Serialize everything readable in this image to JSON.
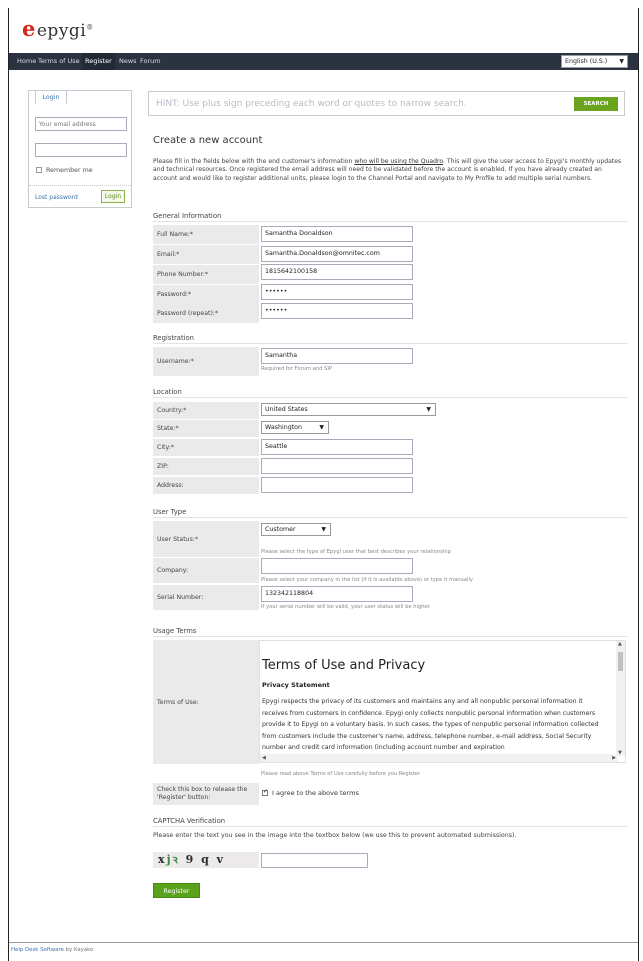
{
  "brand": {
    "logo_text": "epygi",
    "logo_mark": "e"
  },
  "nav": {
    "items": [
      {
        "label": "Home"
      },
      {
        "label": "Terms of Use"
      },
      {
        "label": "Register"
      },
      {
        "label": "News"
      },
      {
        "label": "Forum"
      }
    ],
    "language": "English (U.S.)"
  },
  "login": {
    "tab": "Login",
    "email_placeholder": "Your email address",
    "remember": "Remember me",
    "lost_password": "Lost password",
    "button": "Login"
  },
  "search": {
    "placeholder": "HINT: Use plus sign preceding each word or quotes to narrow search.",
    "button": "SEARCH"
  },
  "page": {
    "title": "Create a new account",
    "intro_1": "Please fill in the fields below with the end customer's information ",
    "intro_link": "who will be using the Quadro",
    "intro_2": ". This will give the user access to Epygi's monthly updates and technical resources. Once registered the email address will need to be validated before the account is enabled. If you have already created an account and would like to register additional units, please login to the Channel Portal and navigate to My Profile to add multiple serial numbers."
  },
  "general": {
    "title": "General Information",
    "full_name_label": "Full Name:*",
    "full_name": "Samantha Donaldson",
    "email_label": "Email:*",
    "email": "Samantha.Donaldson@omnitec.com",
    "phone_label": "Phone Number:*",
    "phone": "1815642100158",
    "password_label": "Password:*",
    "password": "••••••",
    "password2_label": "Password (repeat):*",
    "password2": "••••••"
  },
  "registration": {
    "title": "Registration",
    "username_label": "Username:*",
    "username": "Samantha",
    "username_help": "Required for Forum and SIP"
  },
  "location": {
    "title": "Location",
    "country_label": "Country:*",
    "country": "United States",
    "state_label": "State:*",
    "state": "Washington",
    "city_label": "City:*",
    "city": "Seattle",
    "zip_label": "ZIP:",
    "zip": "",
    "address_label": "Address:",
    "address": ""
  },
  "user_type": {
    "title": "User Type",
    "status_label": "User Status:*",
    "status": "Customer",
    "status_help": "Please select the type of Epygi user that best describes your relationship",
    "company_label": "Company:",
    "company": "",
    "company_help": "Please select your company in the list (if it is available above) or type it manually",
    "serial_label": "Serial Number:",
    "serial": "132342118804",
    "serial_help": "If your serial number will be valid, your user status will be higher"
  },
  "usage": {
    "title": "Usage Terms",
    "tos_label": "Terms of Use:",
    "tos_heading": "Terms of Use and Privacy",
    "tos_sub": "Privacy Statement",
    "tos_text": "Epygi respects the privacy of its customers and maintains any and all nonpublic personal information it receives from customers in confidence. Epygi only collects nonpublic personal information when customers provide it to Epygi on a voluntary basis. In such cases, the types of nonpublic personal information collected from customers include the customer's name, address, telephone number, e-mail address, Social Security number and credit card information (including account number and expiration",
    "tos_help": "Please read above Terms of Use carefully before you Register",
    "check_label": "Check this box to release the 'Register' button:",
    "agree": "I agree to the above terms"
  },
  "captcha": {
    "title": "CAPTCHA Verification",
    "instructions": "Please enter the text you see in the image into the textbox below (we use this to prevent automated submissions).",
    "code_a": "x",
    "code_b": "jꝛ",
    "code_c": " 9 q v"
  },
  "register_button": "Register",
  "footer": {
    "link": "Help Desk Software",
    "by": "by Kayako"
  }
}
